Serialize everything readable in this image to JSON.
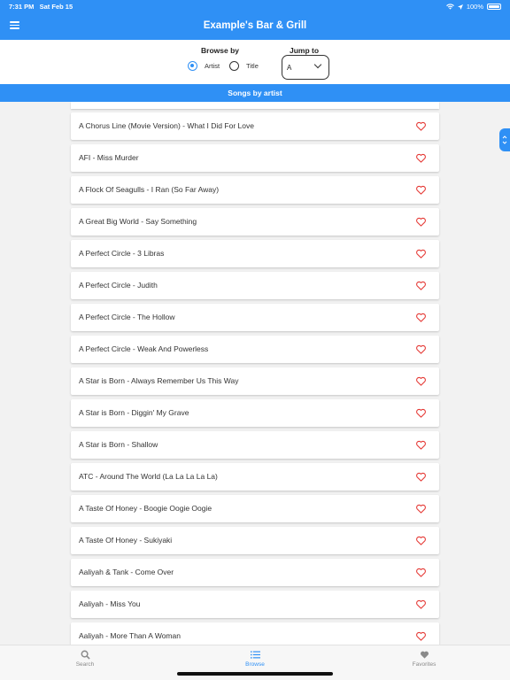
{
  "status_bar": {
    "time": "7:31 PM",
    "date": "Sat Feb 15",
    "battery": "100%"
  },
  "header": {
    "title": "Example's Bar & Grill"
  },
  "browse": {
    "label": "Browse by",
    "options": [
      {
        "label": "Artist",
        "selected": true
      },
      {
        "label": "Title",
        "selected": false
      }
    ]
  },
  "jump": {
    "label": "Jump to",
    "value": "A"
  },
  "section": {
    "title": "Songs by artist"
  },
  "songs": [
    "A Chorus Line (Movie Version) - What I Did For Love",
    "AFI - Miss Murder",
    "A Flock Of Seagulls - I Ran (So Far Away)",
    "A Great Big World - Say Something",
    "A Perfect Circle - 3 Libras",
    "A Perfect Circle - Judith",
    "A Perfect Circle - The Hollow",
    "A Perfect Circle - Weak And Powerless",
    "A Star is Born - Always Remember Us This Way",
    "A Star is Born - Diggin' My Grave",
    "A Star is Born - Shallow",
    "ATC - Around The World (La La La La La)",
    "A Taste Of Honey - Boogie Oogie Oogie",
    "A Taste Of Honey - Sukiyaki",
    "Aaliyah & Tank - Come Over",
    "Aaliyah - Miss You",
    "Aaliyah - More Than A Woman"
  ],
  "tabs": [
    {
      "label": "Search",
      "icon": "search-icon"
    },
    {
      "label": "Browse",
      "icon": "list-icon",
      "active": true
    },
    {
      "label": "Favorites",
      "icon": "heart-icon"
    }
  ],
  "colors": {
    "primary": "#2f90f5",
    "heart": "#e53935",
    "background": "#f2f2f2"
  }
}
